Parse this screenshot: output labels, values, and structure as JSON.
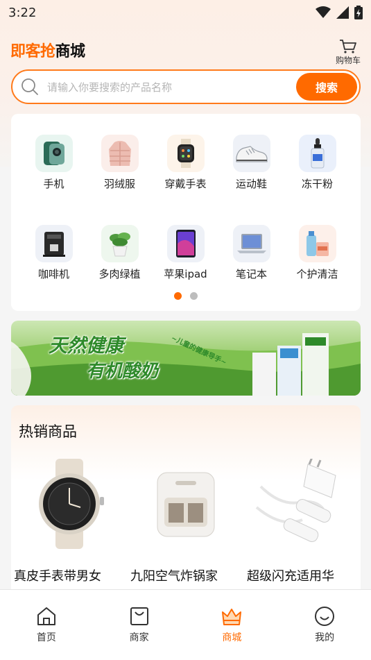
{
  "status_bar": {
    "time": "3:22"
  },
  "header": {
    "brand_part1": "即客抢",
    "brand_part2": "商城",
    "cart_label": "购物车"
  },
  "search": {
    "placeholder": "请输入你要搜索的产品名称",
    "button_label": "搜索"
  },
  "categories": [
    {
      "label": "手机",
      "icon": "phone-icon"
    },
    {
      "label": "羽绒服",
      "icon": "down-jacket-icon"
    },
    {
      "label": "穿戴手表",
      "icon": "smartwatch-icon"
    },
    {
      "label": "运动鞋",
      "icon": "sneaker-icon"
    },
    {
      "label": "冻干粉",
      "icon": "dropper-bottle-icon"
    },
    {
      "label": "咖啡机",
      "icon": "coffee-machine-icon"
    },
    {
      "label": "多肉绿植",
      "icon": "plant-icon"
    },
    {
      "label": "苹果ipad",
      "icon": "tablet-icon"
    },
    {
      "label": "笔记本",
      "icon": "laptop-icon"
    },
    {
      "label": "个护清洁",
      "icon": "cleaning-bottle-icon"
    }
  ],
  "pager": {
    "pages": 2,
    "active": 1
  },
  "banner": {
    "headline1": "天然健康",
    "headline2": "有机酸奶",
    "tag": "~儿童的健康导手~"
  },
  "hot_section": {
    "title": "热销商品",
    "products": [
      {
        "name": "真皮手表带男女",
        "icon": "watch-product-icon"
      },
      {
        "name": "九阳空气炸锅家",
        "icon": "air-fryer-icon"
      },
      {
        "name": "超级闪充适用华",
        "icon": "charger-icon"
      }
    ]
  },
  "tabbar": {
    "tabs": [
      {
        "label": "首页",
        "icon": "home-icon"
      },
      {
        "label": "商家",
        "icon": "shopping-bag-icon"
      },
      {
        "label": "商城",
        "icon": "crown-icon"
      },
      {
        "label": "我的",
        "icon": "smiley-icon"
      }
    ],
    "active_index": 2
  },
  "colors": {
    "accent": "#ff6a00",
    "inactive_dot": "#bdbdbd"
  }
}
